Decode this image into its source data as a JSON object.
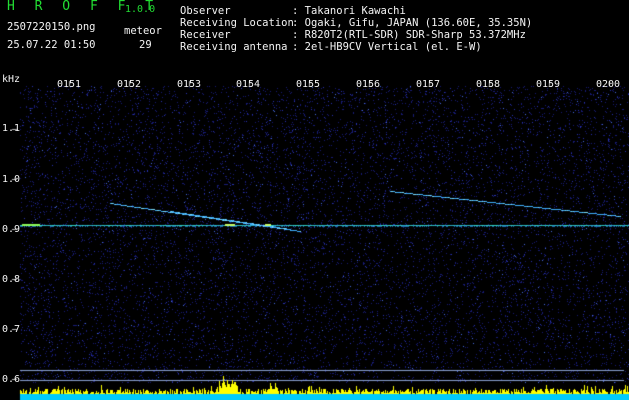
{
  "header": {
    "app_title": "H R O F F T",
    "version": "1.0.0",
    "filename": "2507220150.png",
    "datetime": "25.07.22 01:50",
    "count_label": "meteor",
    "count_value": "29",
    "info": [
      {
        "key": "Observer",
        "value": ": Takanori Kawachi"
      },
      {
        "key": "Receiving Location",
        "value": ": Ogaki, Gifu, JAPAN (136.60E, 35.35N)"
      },
      {
        "key": "Receiver",
        "value": ": R820T2(RTL-SDR) SDR-Sharp 53.372MHz"
      },
      {
        "key": "Receiving antenna",
        "value": ": 2el-HB9CV Vertical (el. E-W)"
      }
    ]
  },
  "axes": {
    "y_unit": "kHz",
    "y_ticks": [
      "1.1",
      "1.0",
      "0.9",
      "0.8",
      "0.7",
      "0.6"
    ],
    "x_ticks": [
      "0151",
      "0152",
      "0153",
      "0154",
      "0155",
      "0156",
      "0157",
      "0158",
      "0159",
      "0200"
    ]
  },
  "colors": {
    "background": "#000000",
    "noise": "#1a1f8a",
    "carrier": "#2fd0c0",
    "echo": "#3fb0ff",
    "histogram": "#ffff00",
    "histogram_base": "#00ccff",
    "header_text": "#f4f4f4",
    "header_green": "#22dd33"
  }
}
